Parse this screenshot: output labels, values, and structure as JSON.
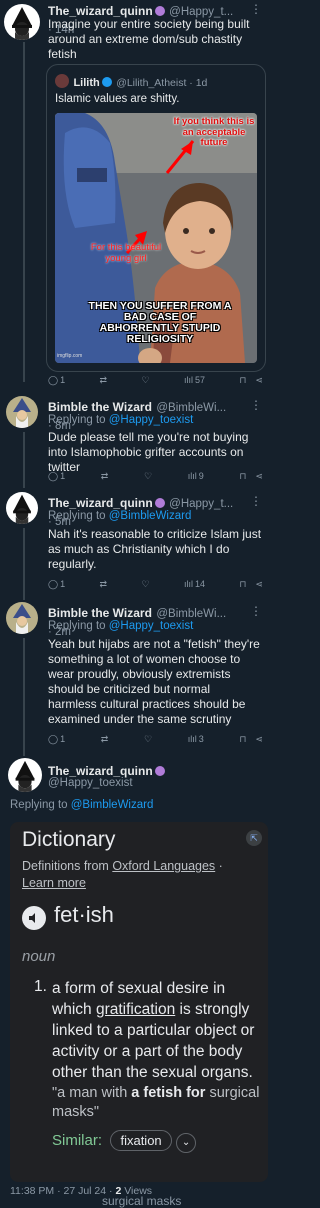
{
  "tweet1": {
    "name": "The_wizard_quinn",
    "handle": "@Happy_t...",
    "time": "· 14h",
    "text": "Imagine your entire society being built around an extreme dom/sub chastity fetish",
    "quote": {
      "name": "Lilith",
      "handle": "@Lilith_Atheist · 1d",
      "text": "Islamic values are shitty.",
      "overlay_top": "If you think this is an acceptable future",
      "overlay_mid": "For this beautiful young girl",
      "overlay_bottom": "THEN YOU SUFFER FROM A BAD CASE OF ABHORRENTLY STUPID RELIGIOSITY",
      "watermark": "imgflip.com"
    },
    "stats": {
      "replies": "1",
      "retweets": "",
      "likes": "",
      "views": "57"
    }
  },
  "tweet2": {
    "name": "Bimble the Wizard",
    "handle": "@BimbleWi...",
    "time": "· 8m",
    "replying_prefix": "Replying to",
    "replying_to": "@Happy_toexist",
    "text": "Dude please tell me you're not buying into Islamophobic grifter accounts on twitter",
    "stats": {
      "replies": "1",
      "retweets": "",
      "likes": "",
      "views": "9"
    }
  },
  "tweet3": {
    "name": "The_wizard_quinn",
    "handle": "@Happy_t...",
    "time": "· 5m",
    "replying_prefix": "Replying to",
    "replying_to": "@BimbleWizard",
    "text": "Nah it's reasonable to criticize Islam just as much as Christianity which I do regularly.",
    "stats": {
      "replies": "1",
      "retweets": "",
      "likes": "",
      "views": "14"
    }
  },
  "tweet4": {
    "name": "Bimble the Wizard",
    "handle": "@BimbleWi...",
    "time": "· 2m",
    "replying_prefix": "Replying to",
    "replying_to": "@Happy_toexist",
    "text": "Yeah but hijabs are not a \"fetish\" they're something a lot of women choose to wear proudly, obviously extremists should be criticized but normal harmless cultural practices should be examined under the same scrutiny",
    "stats": {
      "replies": "1",
      "retweets": "",
      "likes": "",
      "views": "3"
    }
  },
  "tweet5": {
    "name": "The_wizard_quinn",
    "handle": "@Happy_toexist",
    "replying_prefix": "Replying to",
    "replying_to": "@BimbleWizard",
    "dictionary": {
      "title": "Dictionary",
      "source_prefix": "Definitions from",
      "source_name": "Oxford Languages",
      "source_sep": "·",
      "learn_more": "Learn more",
      "word": "fet·ish",
      "pos": "noun",
      "def_number": "1.",
      "def_text_1": "a form of sexual desire in which",
      "def_link": "gratification",
      "def_text_2": "is strongly linked to a particular object or activity or a part of the body other than the sexual organs.",
      "example_pre": "\"a man with",
      "example_bold": "a fetish for",
      "example_post": "surgical masks\"",
      "similar_label": "Similar:",
      "similar_chip": "fixation"
    },
    "timestamp": "11:38 PM · 27 Jul 24 ·",
    "views_count": "2",
    "views_label": "Views",
    "cutoff": "surgical masks"
  },
  "colors": {
    "bg": "#15202b",
    "accent": "#1d9bf0",
    "muted": "#8b98a5",
    "dict_bg": "#202124"
  }
}
